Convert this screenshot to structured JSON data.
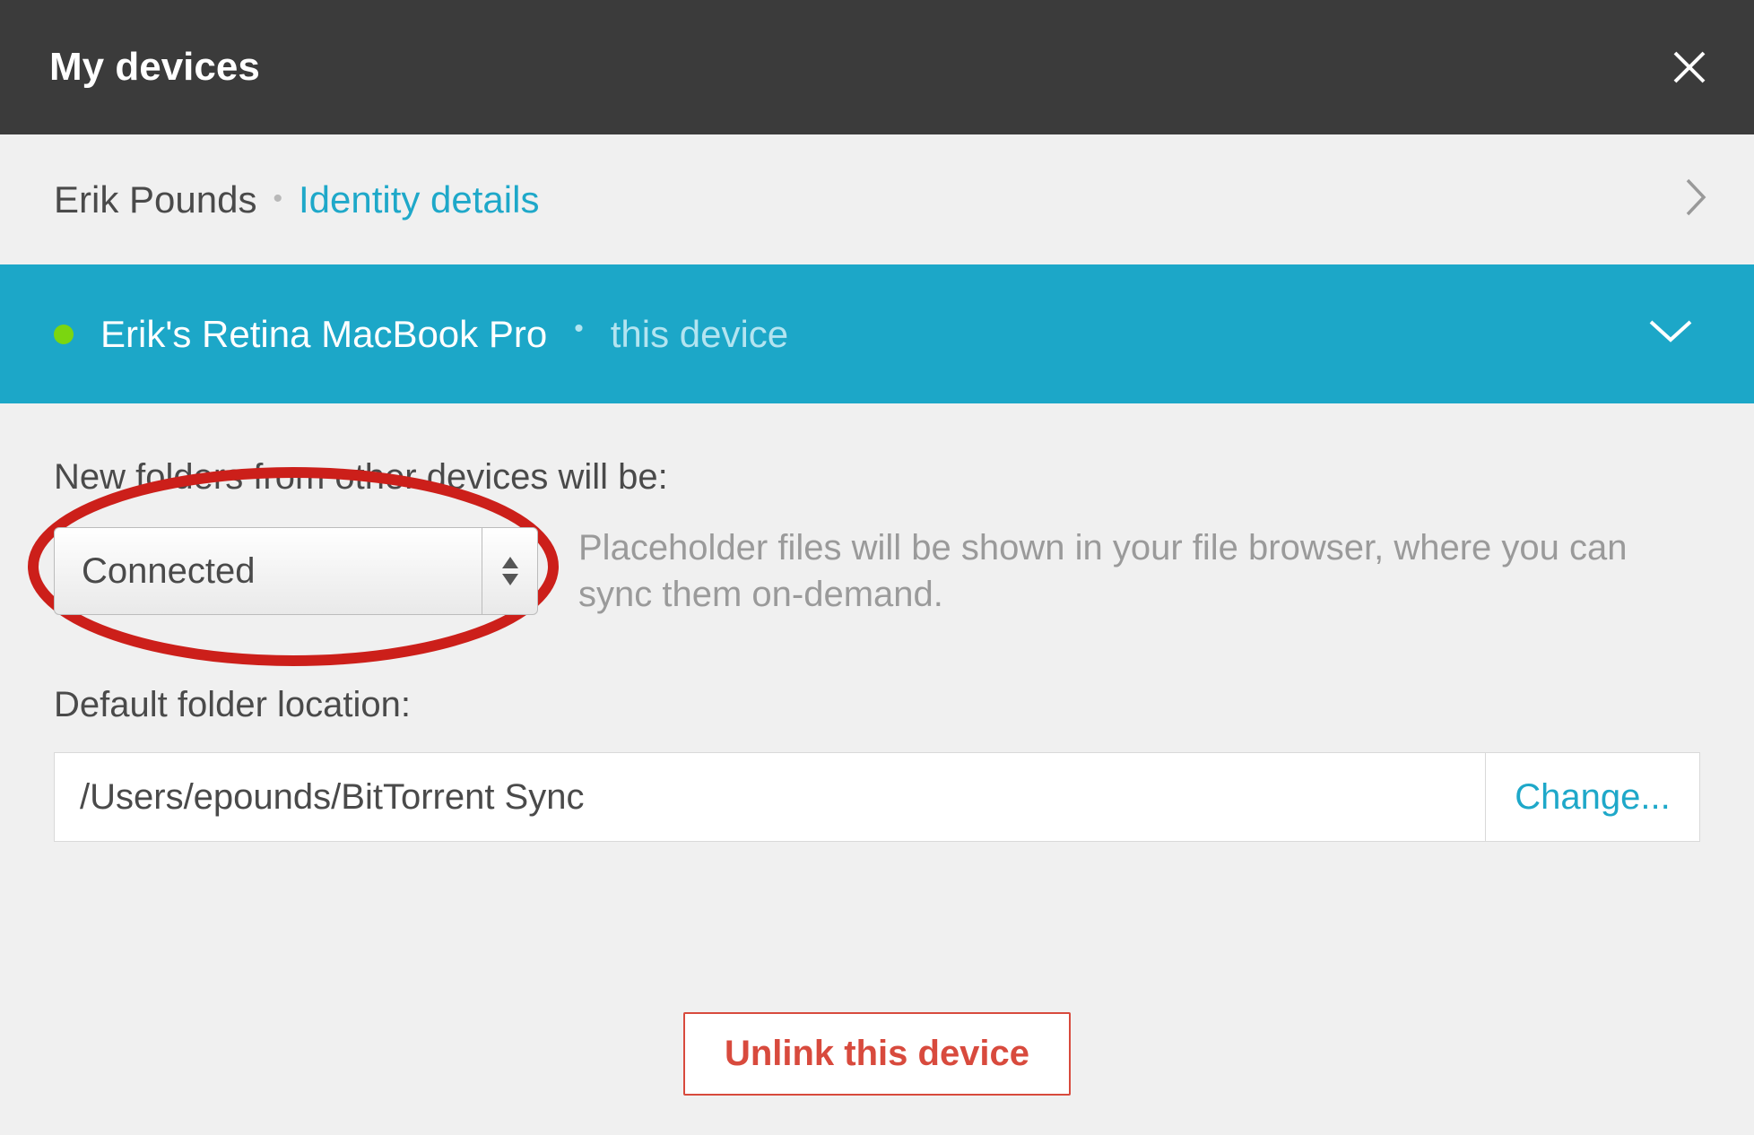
{
  "header": {
    "title": "My devices"
  },
  "identity": {
    "name": "Erik Pounds",
    "details_label": "Identity details"
  },
  "device": {
    "name": "Erik's Retina MacBook Pro",
    "this_label": "this device",
    "status_color": "#7bd610"
  },
  "settings": {
    "new_folders_label": "New folders from other devices will be:",
    "sync_mode_value": "Connected",
    "sync_mode_desc": "Placeholder files will be shown in your file browser, where you can sync them on-demand.",
    "default_location_label": "Default folder location:",
    "default_location_value": "/Users/epounds/BitTorrent Sync",
    "change_label": "Change...",
    "unlink_label": "Unlink this device"
  },
  "colors": {
    "accent": "#1ca7c8",
    "link": "#1ea8c9",
    "danger": "#d84a3d",
    "annotation": "#cc1f1a"
  }
}
